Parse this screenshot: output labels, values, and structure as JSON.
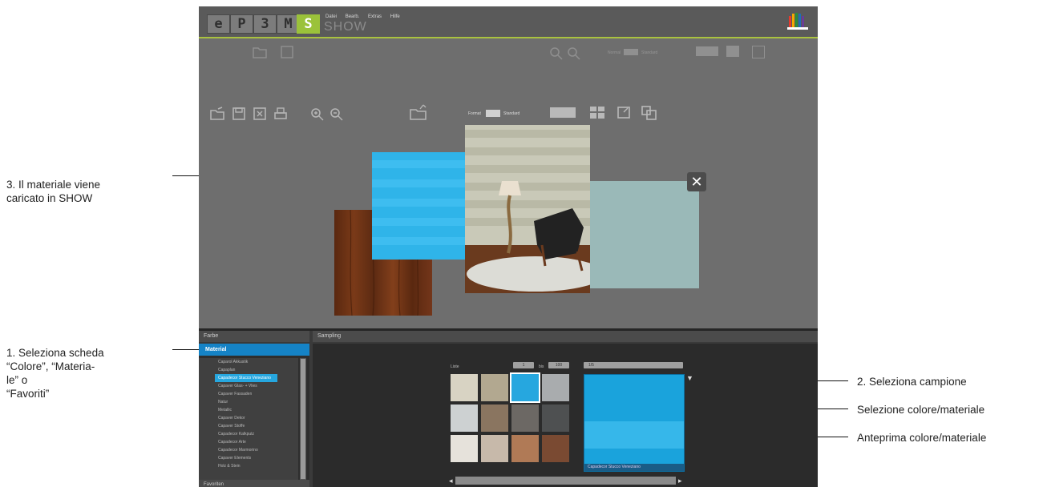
{
  "app": {
    "logo_letters": [
      "e",
      "P",
      "3",
      "M",
      "S"
    ],
    "menu": [
      "Datei",
      "Bearb.",
      "Extras",
      "Hilfe"
    ],
    "name": "SHOW",
    "toolbar_ghost_format_label": "Normal",
    "toolbar_ghost_format_right": "Standard",
    "toolbar_format_label": "Format",
    "toolbar_format_right": "Standard"
  },
  "panels": {
    "tabs_header": "Farbe",
    "active_tab": "Material",
    "favorites_tab": "Favoriten",
    "sampling_header": "Sampling",
    "list_items": [
      "Caparol Akkustik",
      "Capaplan",
      "Capadecor Stucco Veneziano",
      "Capaver Glas- + Vlies",
      "Capaver Fassaden",
      "Natur",
      "Metallic",
      "Capaver Dekor",
      "Capaver Stoffe",
      "Capadecor Kalkputz",
      "Capadecor Arte",
      "Capadecor Marmorino",
      "Capaver Elements",
      "Holz & Stein"
    ],
    "selected_list_index": 2,
    "filter_label_left": "Liste",
    "filter_label_mid": "bis",
    "filter_box_1": "1",
    "filter_box_2": "100",
    "filter_box_3": "1/5",
    "preview_caption": "Capadecor Stucco Veneziano"
  },
  "annotations": {
    "one": [
      "1. Seleziona scheda",
      "“Colore”, “Materia-",
      "le” o",
      "“Favoriti”"
    ],
    "two": "2. Seleziona campione",
    "three": [
      "3. Il materiale viene",
      "caricato in SHOW"
    ],
    "four": "Selezione colore/materiale",
    "five": "Anteprima colore/materiale"
  },
  "colors": {
    "accent_green": "#9bc23a",
    "selection_blue": "#26a7df",
    "app_gray": "#6e6e6e"
  }
}
